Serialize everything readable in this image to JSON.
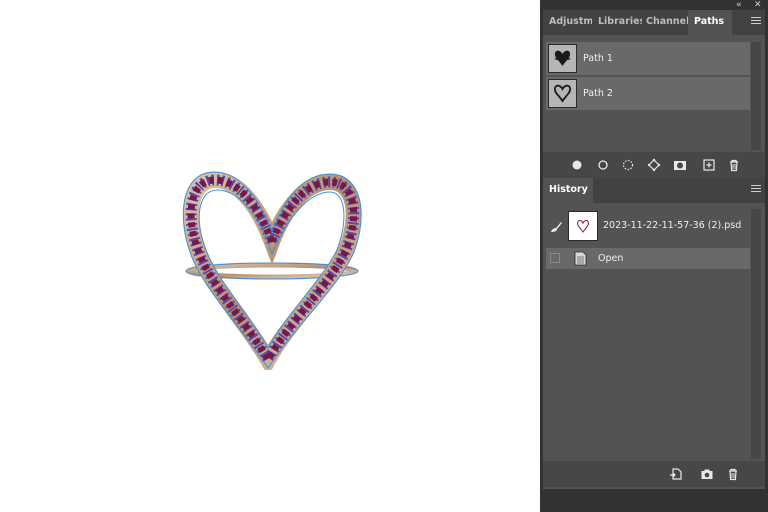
{
  "window": {
    "collapse_icon": "double-chevron-icon",
    "close_icon": "close-icon"
  },
  "paths_panel": {
    "tabs": [
      {
        "label": "Adjustm"
      },
      {
        "label": "Libraries"
      },
      {
        "label": "Channels"
      },
      {
        "label": "Paths"
      }
    ],
    "active_tab": "Paths",
    "items": [
      {
        "label": "Path 1"
      },
      {
        "label": "Path 2"
      }
    ],
    "footer_icons": [
      "fill-path-icon",
      "stroke-path-icon",
      "selection-from-path-icon",
      "path-from-selection-icon",
      "add-mask-icon",
      "new-path-icon",
      "delete-icon"
    ]
  },
  "history_panel": {
    "title": "History",
    "snapshot_label": "2023-11-22-11-57-36 (2).psd",
    "states": [
      {
        "label": "Open"
      }
    ],
    "footer_icons": [
      "new-document-from-state-icon",
      "snapshot-camera-icon",
      "delete-icon"
    ]
  },
  "colors": {
    "panel_bg": "#535353",
    "dock_bg": "#323232",
    "selected_row": "#696969",
    "path_outline": "#3b8fe0",
    "gem": "#7a1550",
    "metal": "#c9a98c"
  }
}
